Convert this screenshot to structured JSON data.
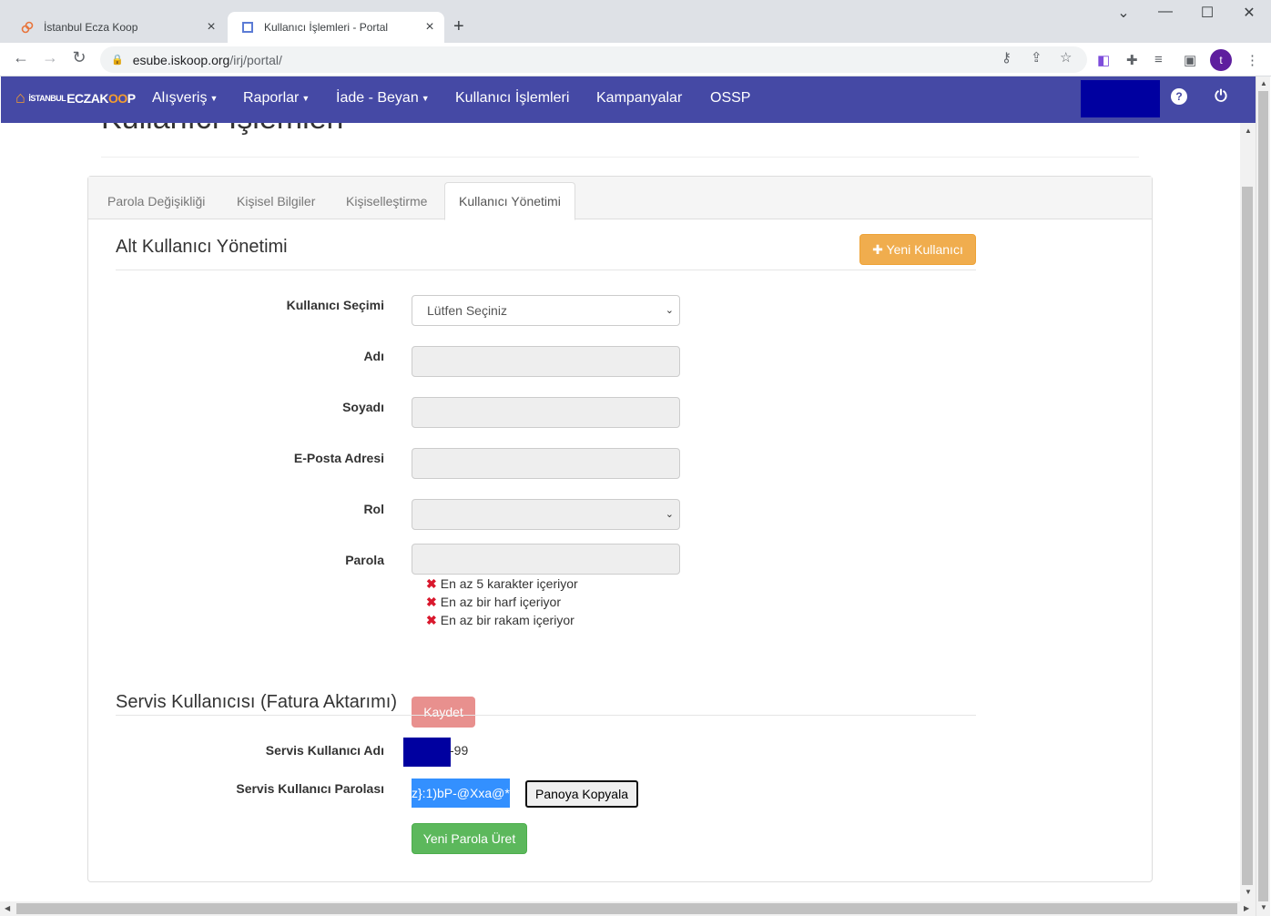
{
  "browser": {
    "tabs": [
      {
        "title": "İstanbul Ecza Koop",
        "active": false
      },
      {
        "title": "Kullanıcı İşlemleri - Portal",
        "active": true
      }
    ],
    "url_host": "esube.iskoop.org",
    "url_path": "/irj/portal/",
    "profile_initial": "t"
  },
  "appnav": {
    "logo_prefix": "İSTANBUL",
    "logo_main": "ECZAK",
    "logo_o": "OO",
    "logo_end": "P",
    "items": [
      {
        "label": "Alışveriş",
        "dropdown": true
      },
      {
        "label": "Raporlar",
        "dropdown": true
      },
      {
        "label": "İade - Beyan",
        "dropdown": true
      },
      {
        "label": "Kullanıcı İşlemleri",
        "dropdown": false
      },
      {
        "label": "Kampanyalar",
        "dropdown": false
      },
      {
        "label": "OSSP",
        "dropdown": false
      }
    ],
    "help_icon": "?",
    "accent": "#4549a5"
  },
  "page": {
    "title": "Kullanıcı İşlemleri",
    "tabs": [
      "Parola Değişikliği",
      "Kişisel Bilgiler",
      "Kişiselleştirme",
      "Kullanıcı Yönetimi"
    ],
    "active_tab": 3
  },
  "subuser": {
    "title": "Alt Kullanıcı Yönetimi",
    "new_button": "Yeni Kullanıcı",
    "fields": {
      "select_label": "Kullanıcı Seçimi",
      "select_value": "Lütfen Seçiniz",
      "name_label": "Adı",
      "surname_label": "Soyadı",
      "email_label": "E-Posta Adresi",
      "role_label": "Rol",
      "password_label": "Parola"
    },
    "rules": [
      "En az 5 karakter içeriyor",
      "En az bir harf içeriyor",
      "En az bir rakam içeriyor"
    ],
    "save_button": "Kaydet"
  },
  "service": {
    "title": "Servis Kullanıcısı (Fatura Aktarımı)",
    "username_label": "Servis Kullanıcı Adı",
    "username_suffix": "-99",
    "password_label": "Servis Kullanıcı Parolası",
    "password_value": "z}:1)bP-@Xxa@*",
    "copy_button": "Panoya Kopyala",
    "generate_button": "Yeni Parola Üret"
  }
}
